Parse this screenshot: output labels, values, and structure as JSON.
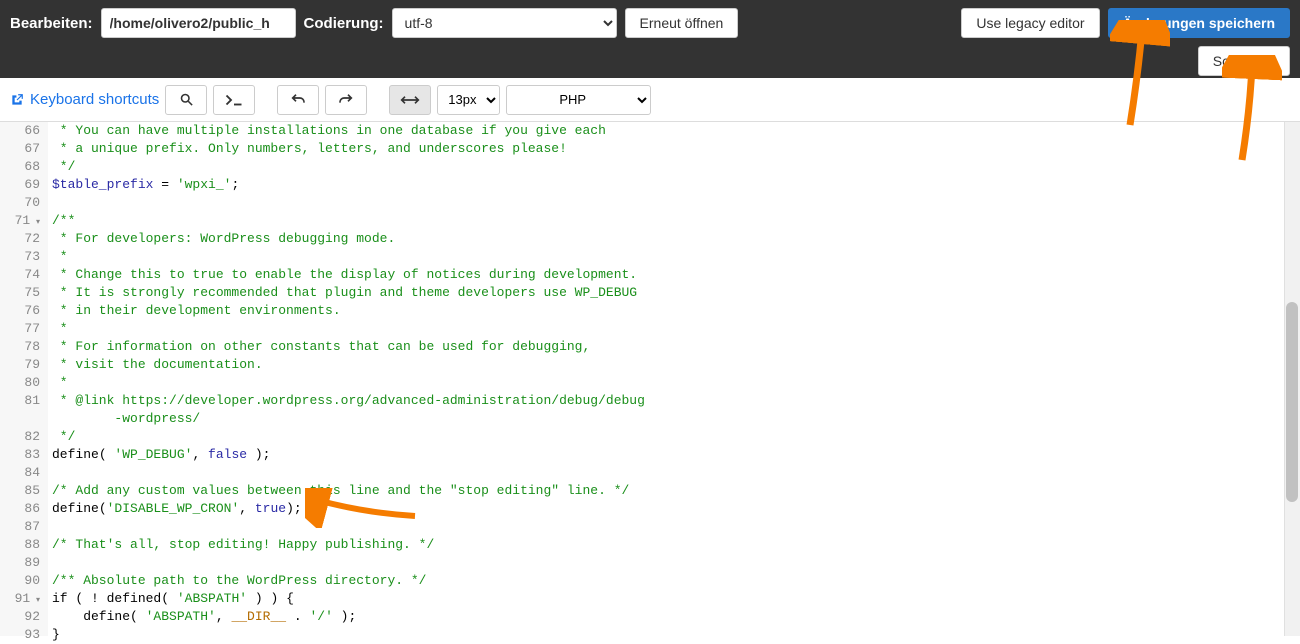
{
  "topbar": {
    "edit_label": "Bearbeiten:",
    "path_value": "/home/olivero2/public_h",
    "encoding_label": "Codierung:",
    "encoding_value": "utf-8",
    "reopen_label": "Erneut öffnen",
    "legacy_label": "Use legacy editor",
    "save_label": "Änderungen speichern",
    "close_label": "Schließen"
  },
  "secondbar": {
    "keyboard_shortcuts": "Keyboard shortcuts",
    "fontsize": "13px",
    "language": "PHP"
  },
  "code": {
    "lines": [
      {
        "n": 66,
        "segs": [
          {
            "t": " * You can have multiple installations in one database if you give each",
            "c": "c-comment"
          }
        ]
      },
      {
        "n": 67,
        "segs": [
          {
            "t": " * a unique prefix. Only numbers, letters, and underscores please!",
            "c": "c-comment"
          }
        ]
      },
      {
        "n": 68,
        "segs": [
          {
            "t": " */",
            "c": "c-comment"
          }
        ]
      },
      {
        "n": 69,
        "segs": [
          {
            "t": "$table_prefix",
            "c": "c-var"
          },
          {
            "t": " = "
          },
          {
            "t": "'wpxi_'",
            "c": "c-str"
          },
          {
            "t": ";"
          }
        ]
      },
      {
        "n": 70,
        "segs": []
      },
      {
        "n": 71,
        "fold": true,
        "segs": [
          {
            "t": "/**",
            "c": "c-comment"
          }
        ]
      },
      {
        "n": 72,
        "segs": [
          {
            "t": " * For developers: WordPress debugging mode.",
            "c": "c-comment"
          }
        ]
      },
      {
        "n": 73,
        "segs": [
          {
            "t": " *",
            "c": "c-comment"
          }
        ]
      },
      {
        "n": 74,
        "segs": [
          {
            "t": " * Change this to true to enable the display of notices during development.",
            "c": "c-comment"
          }
        ]
      },
      {
        "n": 75,
        "segs": [
          {
            "t": " * It is strongly recommended that plugin and theme developers use WP_DEBUG",
            "c": "c-comment"
          }
        ]
      },
      {
        "n": 76,
        "segs": [
          {
            "t": " * in their development environments.",
            "c": "c-comment"
          }
        ]
      },
      {
        "n": 77,
        "segs": [
          {
            "t": " *",
            "c": "c-comment"
          }
        ]
      },
      {
        "n": 78,
        "segs": [
          {
            "t": " * For information on other constants that can be used for debugging,",
            "c": "c-comment"
          }
        ]
      },
      {
        "n": 79,
        "segs": [
          {
            "t": " * visit the documentation.",
            "c": "c-comment"
          }
        ]
      },
      {
        "n": 80,
        "segs": [
          {
            "t": " *",
            "c": "c-comment"
          }
        ]
      },
      {
        "n": 81,
        "segs": [
          {
            "t": " * @link https://developer.wordpress.org/advanced-administration/debug/debug",
            "c": "c-comment"
          }
        ]
      },
      {
        "n": "",
        "segs": [
          {
            "t": "        -wordpress/",
            "c": "c-comment"
          }
        ]
      },
      {
        "n": 82,
        "segs": [
          {
            "t": " */",
            "c": "c-comment"
          }
        ]
      },
      {
        "n": 83,
        "segs": [
          {
            "t": "define"
          },
          {
            "t": "( "
          },
          {
            "t": "'WP_DEBUG'",
            "c": "c-str"
          },
          {
            "t": ", "
          },
          {
            "t": "false",
            "c": "c-kw"
          },
          {
            "t": " );"
          }
        ]
      },
      {
        "n": 84,
        "segs": []
      },
      {
        "n": 85,
        "segs": [
          {
            "t": "/* Add any custom values between this line and the \"stop editing\" line. */",
            "c": "c-comment"
          }
        ]
      },
      {
        "n": 86,
        "segs": [
          {
            "t": "define"
          },
          {
            "t": "("
          },
          {
            "t": "'DISABLE_WP_CRON'",
            "c": "c-str"
          },
          {
            "t": ", "
          },
          {
            "t": "true",
            "c": "c-kw"
          },
          {
            "t": ");"
          }
        ]
      },
      {
        "n": 87,
        "segs": []
      },
      {
        "n": 88,
        "segs": [
          {
            "t": "/* That's all, stop editing! Happy publishing. */",
            "c": "c-comment"
          }
        ]
      },
      {
        "n": 89,
        "segs": []
      },
      {
        "n": 90,
        "segs": [
          {
            "t": "/** Absolute path to the WordPress directory. */",
            "c": "c-comment"
          }
        ]
      },
      {
        "n": 91,
        "fold": true,
        "segs": [
          {
            "t": "if"
          },
          {
            "t": " ( ! "
          },
          {
            "t": "defined"
          },
          {
            "t": "( "
          },
          {
            "t": "'ABSPATH'",
            "c": "c-str"
          },
          {
            "t": " ) ) {"
          }
        ]
      },
      {
        "n": 92,
        "segs": [
          {
            "t": "    define"
          },
          {
            "t": "( "
          },
          {
            "t": "'ABSPATH'",
            "c": "c-str"
          },
          {
            "t": ", "
          },
          {
            "t": "__DIR__",
            "c": "c-const"
          },
          {
            "t": " . "
          },
          {
            "t": "'/'",
            "c": "c-str"
          },
          {
            "t": " );"
          }
        ]
      },
      {
        "n": 93,
        "segs": [
          {
            "t": "}"
          }
        ]
      }
    ]
  }
}
